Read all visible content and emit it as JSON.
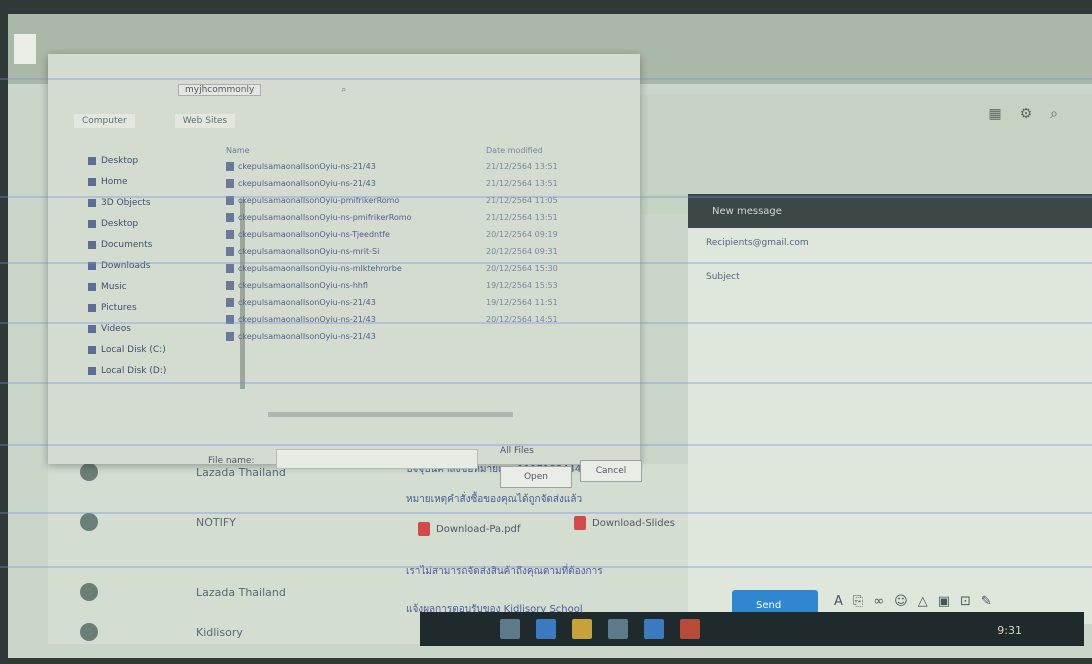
{
  "background_window": {
    "icons": [
      "grid-icon",
      "settings-icon",
      "search-icon"
    ]
  },
  "file_dialog": {
    "path_label": "myjhcommonly",
    "tabs": [
      "Computer",
      "Web Sites"
    ],
    "sidebar": [
      "Desktop",
      "Home",
      "3D Objects",
      "Desktop",
      "Documents",
      "Downloads",
      "Music",
      "Pictures",
      "Videos",
      "Local Disk (C:)",
      "Local Disk (D:)"
    ],
    "columns": {
      "name": "Name",
      "date": "Date modified"
    },
    "files": [
      {
        "name": "ckepulsamaonalIsonOyiu-ns-21/43",
        "date": "21/12/2564 13:51"
      },
      {
        "name": "ckepulsamaonalIsonOyiu-ns-21/43",
        "date": "21/12/2564 13:51"
      },
      {
        "name": "ckepulsamaonalIsonOyiu-pmifrikerRomo",
        "date": "21/12/2564 11:05"
      },
      {
        "name": "ckepulsamaonalIsonOyiu-ns-pmifrikerRomo",
        "date": "21/12/2564 13:51"
      },
      {
        "name": "ckepulsamaonalIsonOyiu-ns-Tjeedntfe",
        "date": "20/12/2564 09:19"
      },
      {
        "name": "ckepulsamaonalIsonOyiu-ns-mrit-Si",
        "date": "20/12/2564 09:31"
      },
      {
        "name": "ckepulsamaonalIsonOyiu-ns-mlktehrorbe",
        "date": "20/12/2564 15:30"
      },
      {
        "name": "ckepulsamaonalIsonOyiu-ns-hhfl",
        "date": "19/12/2564 15:53"
      },
      {
        "name": "ckepulsamaonalIsonOyiu-ns-21/43",
        "date": "19/12/2564 11:51"
      },
      {
        "name": "ckepulsamaonalIsonOyiu-ns-21/43",
        "date": "20/12/2564 14:51"
      },
      {
        "name": "ckepulsamaonalIsonOyiu-ns-21/43",
        "date": ""
      }
    ],
    "file_name_label": "File name:",
    "file_type": "All Files",
    "open_label": "Open",
    "cancel_label": "Cancel"
  },
  "mail_list": [
    {
      "sender": "Lazada Thailand",
      "line": "ปัจจุบันคำสั่งซื้อหมายเลข 111718844400031 และ"
    },
    {
      "sender": "NOTIFY",
      "line": "หมายเหตุคำสั่งซื้อของคุณได้ถูกจัดส่งแล้ว"
    },
    {
      "sender": "Lazada Thailand",
      "line": "เราไม่สามารถจัดส่งสินค้าถึงคุณตามที่ต้องการ"
    },
    {
      "sender": "Kidlisory",
      "line": "แจ้งผลการตอบรับของ Kidlisory School"
    }
  ],
  "attachments": [
    "Download-Pa.pdf",
    "Download-Slides"
  ],
  "compose": {
    "title": "New message",
    "to": "Recipients@gmail.com",
    "subject": "Subject",
    "send_label": "Send"
  },
  "taskbar": {
    "clock": "9:31"
  }
}
